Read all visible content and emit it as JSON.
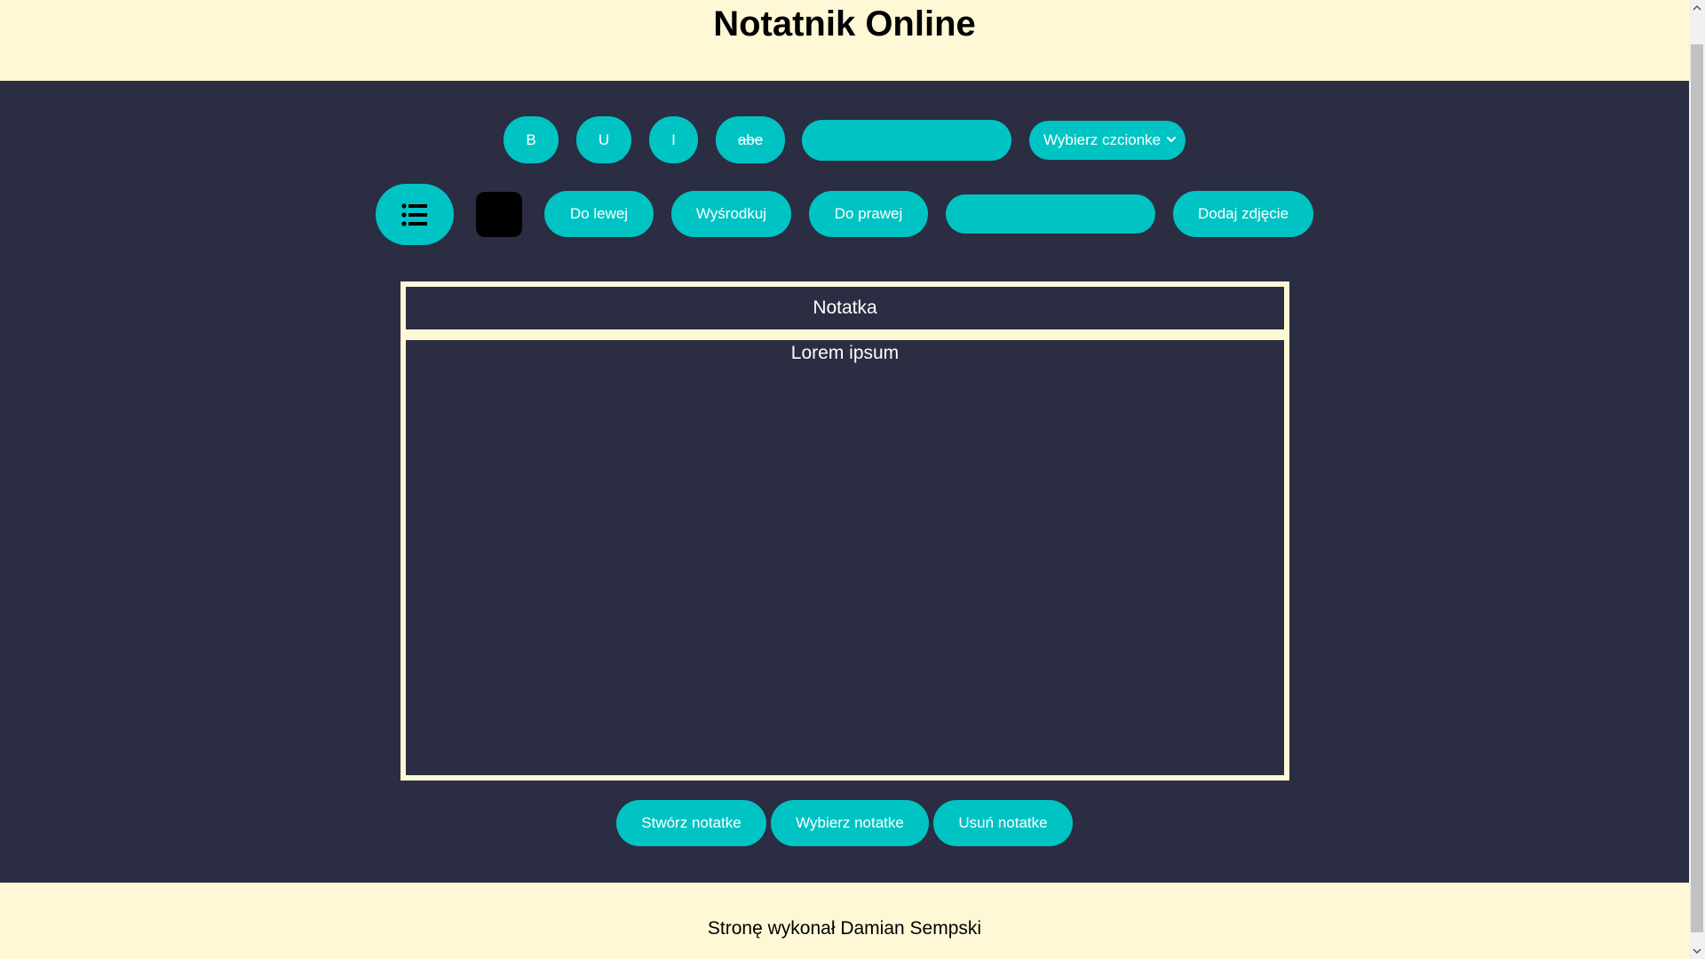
{
  "header": {
    "title": "Notatnik Online"
  },
  "toolbar_row1": {
    "bold_label": "B",
    "underline_label": "U",
    "italic_label": "I",
    "strike_label": "abe",
    "font_size_input_value": "",
    "font_select_value": "Wybierz czcionke"
  },
  "toolbar_row2": {
    "list_icon": "list-icon",
    "color_value": "#000000",
    "align_left_label": "Do lewej",
    "align_center_label": "Wyśrodkuj",
    "align_right_label": "Do prawej",
    "image_url_input_value": "",
    "add_image_label": "Dodaj zdjęcie"
  },
  "note": {
    "title": "Notatka",
    "body": "Lorem ipsum"
  },
  "actions": {
    "create_label": "Stwórz notatke",
    "choose_label": "Wybierz notatke",
    "delete_label": "Usuń notatke"
  },
  "footer": {
    "credit": "Stronę wykonał Damian Sempski"
  },
  "colors": {
    "accent": "#00c4c4",
    "background": "#2b2d42",
    "header_footer": "#fff8d6"
  }
}
